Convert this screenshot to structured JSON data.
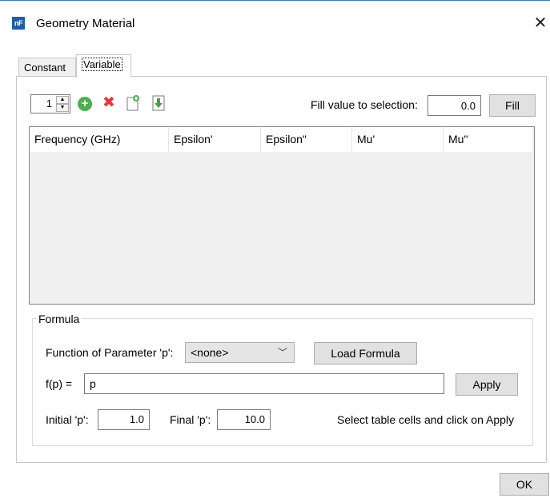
{
  "window": {
    "title": "Geometry Material",
    "app_icon_text": "nF",
    "close_symbol": "✕"
  },
  "tabs": [
    {
      "label": "Constant",
      "selected": false
    },
    {
      "label": "Variable",
      "selected": true
    }
  ],
  "toolbar": {
    "row_count_value": "1",
    "icons": [
      "add-icon",
      "delete-icon",
      "new-document-icon",
      "import-icon"
    ],
    "fill_label": "Fill value to selection:",
    "fill_value": "0.0",
    "fill_button": "Fill"
  },
  "table": {
    "columns": [
      "Frequency (GHz)",
      "Epsilon'",
      "Epsilon\"",
      "Mu'",
      "Mu\""
    ],
    "rows": []
  },
  "formula": {
    "group_title": "Formula",
    "function_label": "Function of Parameter 'p':",
    "function_selected": "<none>",
    "load_button": "Load Formula",
    "fp_label": "f(p) =",
    "fp_value": "p",
    "apply_button": "Apply",
    "initial_label": "Initial 'p':",
    "initial_value": "1.0",
    "final_label": "Final 'p':",
    "final_value": "10.0",
    "hint": "Select table cells and click on Apply"
  },
  "footer": {
    "ok_button": "OK"
  },
  "colors": {
    "accent": "#1f5fa8",
    "button_bg": "#e1e1e1",
    "table_bg": "#f0f0f0"
  }
}
